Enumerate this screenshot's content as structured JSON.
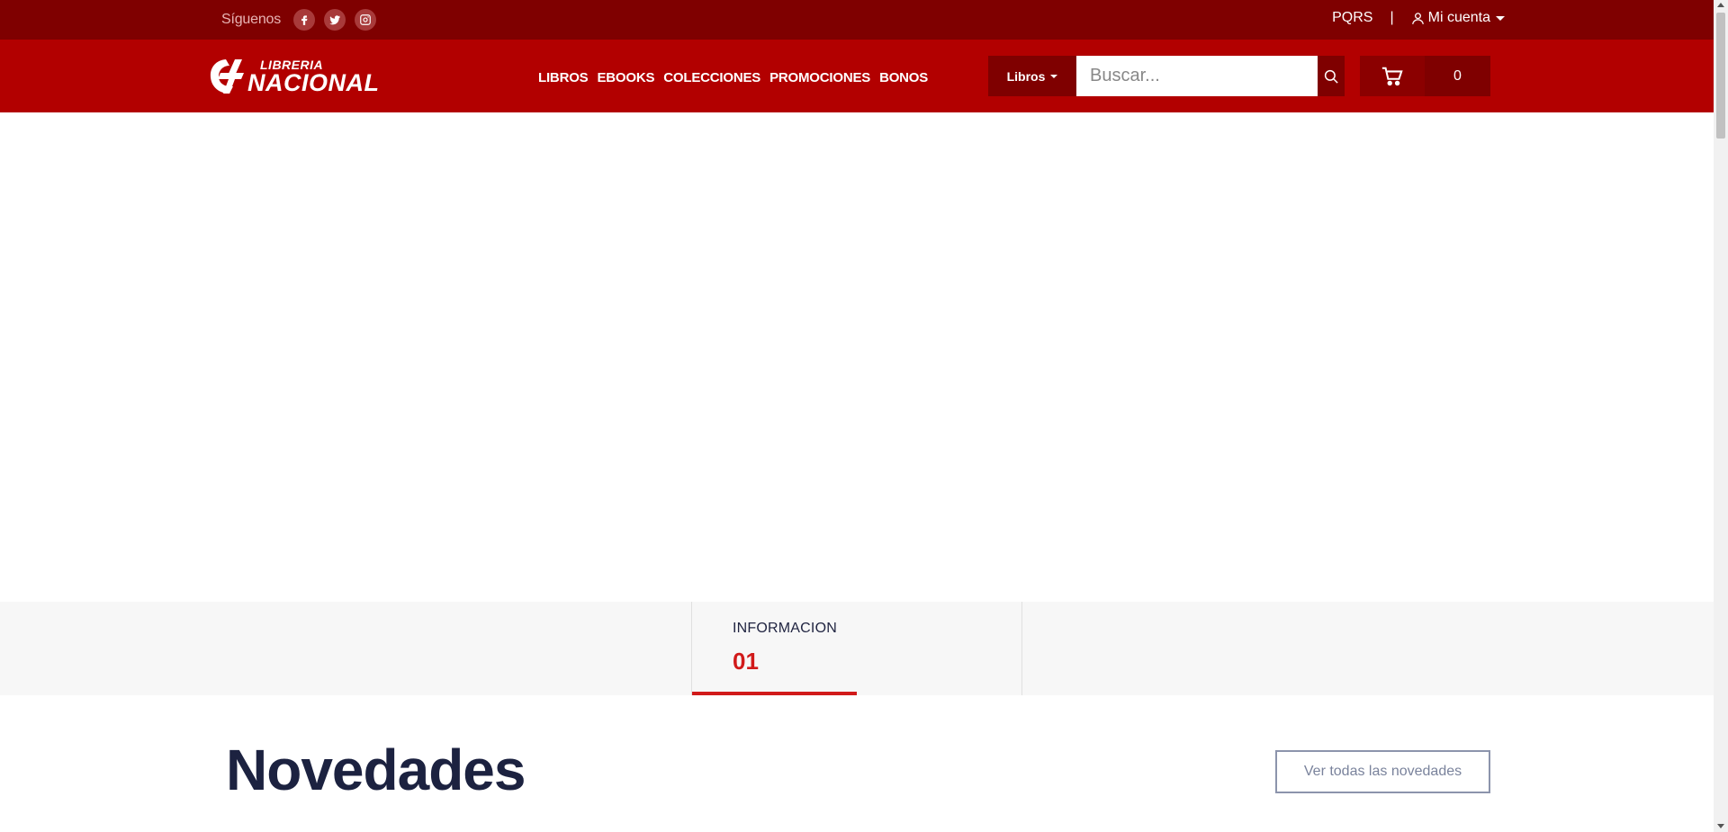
{
  "topbar": {
    "follow_label": "Síguenos",
    "social": [
      "facebook-icon",
      "twitter-icon",
      "instagram-icon"
    ],
    "pqrs": "PQRS",
    "separator": "|",
    "account_label": "Mi cuenta"
  },
  "header": {
    "logo_top": "LIBRERIA",
    "logo_bottom": "NACIONAL",
    "nav": [
      "LIBROS",
      "EBOOKS",
      "COLECCIONES",
      "PROMOCIONES",
      "BONOS"
    ],
    "search_category": "Libros",
    "search_placeholder": "Buscar...",
    "cart_count": "0"
  },
  "slider_tabs": [
    {
      "label": "INFORMACION",
      "number": "01",
      "progress": 0.5
    }
  ],
  "novedades": {
    "title": "Novedades",
    "button": "Ver todas las novedades"
  },
  "colors": {
    "topbar_bg": "#7f0000",
    "header_bg": "#b20000",
    "accent_red": "#d11a1a",
    "title_navy": "#1c2240"
  }
}
